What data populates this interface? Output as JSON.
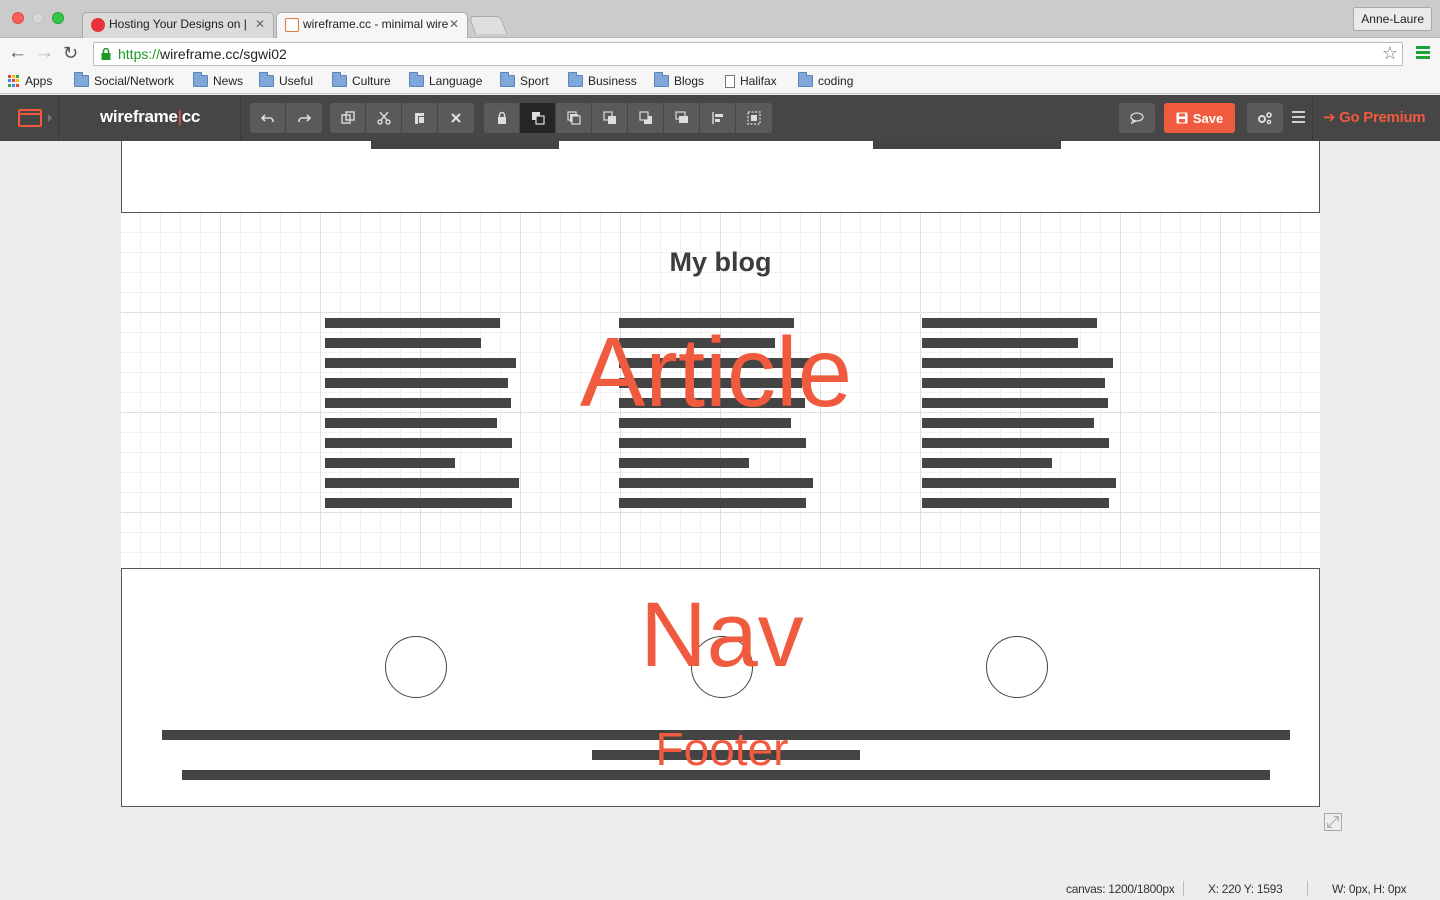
{
  "browser": {
    "tabs": [
      {
        "title": "Hosting Your Designs on | ",
        "active": false
      },
      {
        "title": "wireframe.cc - minimal wire",
        "active": true
      }
    ],
    "profile_name": "Anne-Laure",
    "url_scheme": "https://",
    "url_rest": "wireframe.cc/sgwi02",
    "bookmarks": [
      {
        "label": "Apps",
        "icon": "apps-grid-icon"
      },
      {
        "label": "Social/Network",
        "icon": "folder-icon"
      },
      {
        "label": "News",
        "icon": "folder-icon"
      },
      {
        "label": "Useful",
        "icon": "folder-icon"
      },
      {
        "label": "Culture",
        "icon": "folder-icon"
      },
      {
        "label": "Language",
        "icon": "folder-icon"
      },
      {
        "label": "Sport",
        "icon": "folder-icon"
      },
      {
        "label": "Business",
        "icon": "folder-icon"
      },
      {
        "label": "Blogs",
        "icon": "folder-icon"
      },
      {
        "label": "Halifax",
        "icon": "page-icon"
      },
      {
        "label": "coding",
        "icon": "folder-icon"
      }
    ]
  },
  "app": {
    "brand_left": "wireframe",
    "brand_pipe": "|",
    "brand_right": "cc",
    "save_label": "Save",
    "premium_label": "Go Premium",
    "accent_color": "#f05a3e",
    "toolbar_groups": [
      [
        "undo-icon",
        "redo-icon"
      ],
      [
        "duplicate-icon",
        "cut-icon",
        "paste-icon",
        "delete-icon"
      ],
      [
        "lock-icon",
        "bring-forward-icon",
        "send-backward-icon",
        "bring-to-front-icon",
        "send-to-back-icon",
        "stack-icon",
        "align-left-icon",
        "group-icon"
      ]
    ]
  },
  "canvas": {
    "blog_title": "My blog",
    "overlay_article": "Article",
    "overlay_nav": "Nav",
    "overlay_footer": "Footer"
  },
  "status": {
    "canvas_size": "canvas: 1200/1800px",
    "coords": "X: 220 Y: 1593",
    "dims": "W: 0px, H: 0px"
  }
}
